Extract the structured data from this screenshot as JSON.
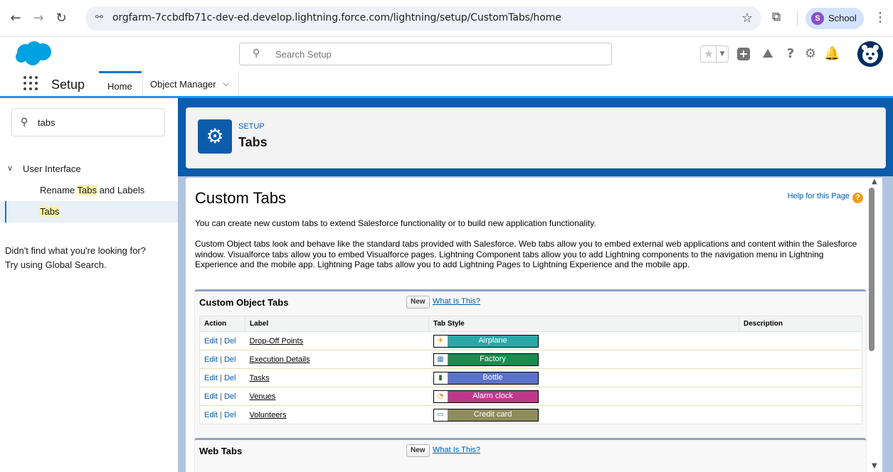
{
  "browser": {
    "url_host_path": "orgfarm-7ccbdfb71c-dev-ed.develop.lightning.force.com/lightning/setup/CustomTabs/home",
    "profile_initial": "S",
    "profile_name": "School"
  },
  "global_header": {
    "search_placeholder": "Search Setup",
    "help_glyph": "?"
  },
  "app_nav": {
    "app_name": "Setup",
    "tabs": [
      {
        "label": "Home"
      },
      {
        "label": "Object Manager"
      }
    ]
  },
  "sidebar": {
    "quick_find_value": "tabs",
    "tree_parent": "User Interface",
    "items": [
      {
        "before": "Rename ",
        "match": "Tabs",
        "after": " and Labels"
      },
      {
        "before": "",
        "match": "Tabs",
        "after": ""
      }
    ],
    "not_found_line1": "Didn't find what you're looking for?",
    "not_found_line2": "Try using Global Search."
  },
  "page_header": {
    "eyebrow": "SETUP",
    "title": "Tabs"
  },
  "content": {
    "heading": "Custom Tabs",
    "help_link": "Help for this Page",
    "intro": "You can create new custom tabs to extend Salesforce functionality or to build new application functionality.",
    "description": "Custom Object tabs look and behave like the standard tabs provided with Salesforce. Web tabs allow you to embed external web applications and content within the Salesforce window. Visualforce tabs allow you to embed Visualforce pages. Lightning Component tabs allow you to add Lightning components to the navigation menu in Lightning Experience and the mobile app. Lightning Page tabs allow you to add Lightning Pages to Lightning Experience and the mobile app."
  },
  "custom_object_tabs": {
    "title": "Custom Object Tabs",
    "new_label": "New",
    "what_label": "What Is This?",
    "columns": [
      "Action",
      "Label",
      "Tab Style",
      "Description"
    ],
    "edit_label": "Edit",
    "del_label": "Del",
    "separator": "|",
    "rows": [
      {
        "label": "Drop-Off Points",
        "style": "Airplane",
        "color": "#2aa8a8",
        "icon": "airplane-icon",
        "glyph": "✈",
        "glyph_color": "#e8900c",
        "description": ""
      },
      {
        "label": "Execution Details",
        "style": "Factory",
        "color": "#1a8c50",
        "icon": "factory-icon",
        "glyph": "▦",
        "glyph_color": "#4c7fb3",
        "description": ""
      },
      {
        "label": "Tasks",
        "style": "Bottle",
        "color": "#5b72c9",
        "icon": "bottle-icon",
        "glyph": "▮",
        "glyph_color": "#2f6b3a",
        "description": ""
      },
      {
        "label": "Venues",
        "style": "Alarm clock",
        "color": "#c0388c",
        "icon": "alarm-clock-icon",
        "glyph": "◔",
        "glyph_color": "#d89020",
        "description": ""
      },
      {
        "label": "Volunteers",
        "style": "Credit card",
        "color": "#8f8c5c",
        "icon": "credit-card-icon",
        "glyph": "▭",
        "glyph_color": "#3a6fb0",
        "description": ""
      }
    ]
  },
  "web_tabs": {
    "title": "Web Tabs",
    "new_label": "New",
    "what_label": "What Is This?"
  }
}
